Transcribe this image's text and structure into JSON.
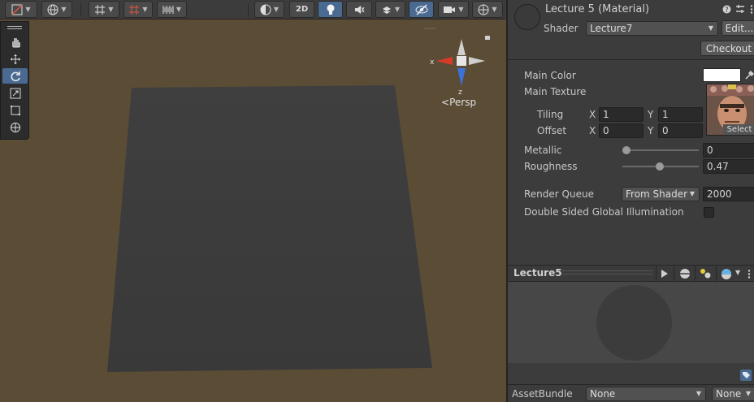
{
  "scene": {
    "gizmo_axis_x": "x",
    "gizmo_axis_z": "z",
    "view_mode": "Persp",
    "toolbar_2d_label": "2D",
    "colors": {
      "background": "#5b4c35",
      "plane": "#3b3b3b",
      "x_axis": "#d83a2a",
      "z_axis": "#3a73d8"
    }
  },
  "tools": [
    {
      "name": "hand-tool",
      "icon": "hand-icon"
    },
    {
      "name": "move-tool",
      "icon": "move-icon"
    },
    {
      "name": "rotate-tool",
      "icon": "rotate-icon",
      "active": true
    },
    {
      "name": "scale-tool",
      "icon": "scale-icon"
    },
    {
      "name": "rect-tool",
      "icon": "rect-icon"
    },
    {
      "name": "transform-tool",
      "icon": "transform-icon"
    }
  ],
  "inspector": {
    "title": "Lecture 5 (Material)",
    "shader_label": "Shader",
    "shader_value": "Lecture7",
    "edit_button": "Edit...",
    "checkout_button": "Checkout",
    "main_color_label": "Main Color",
    "main_texture_label": "Main Texture",
    "select_label": "Select",
    "tiling_label": "Tiling",
    "offset_label": "Offset",
    "x_label": "X",
    "y_label": "Y",
    "tiling_x": "1",
    "tiling_y": "1",
    "offset_x": "0",
    "offset_y": "0",
    "metallic_label": "Metallic",
    "metallic_value": "0",
    "roughness_label": "Roughness",
    "roughness_value": "0.47",
    "render_queue_label": "Render Queue",
    "render_queue_mode": "From Shader",
    "render_queue_value": "2000",
    "double_sided_gi_label": "Double Sided Global Illumination",
    "double_sided_gi_checked": false
  },
  "preview": {
    "title": "Lecture5"
  },
  "asset_bundle": {
    "label": "AssetBundle",
    "name_value": "None",
    "variant_value": "None"
  }
}
